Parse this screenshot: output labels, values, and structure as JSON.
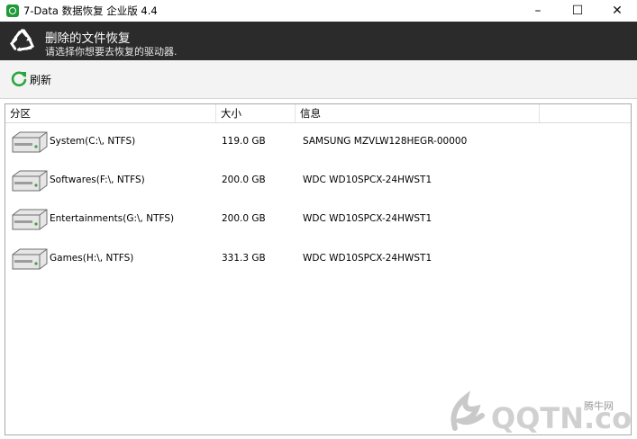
{
  "window": {
    "title": "7-Data 数据恢复 企业版 4.4",
    "buttons": [
      "–",
      "☐",
      "✕"
    ]
  },
  "banner": {
    "title": "删除的文件恢复",
    "subtitle": "请选择你想要去恢复的驱动器."
  },
  "toolbar": {
    "refresh_label": "刷新"
  },
  "table": {
    "columns": [
      "分区",
      "大小",
      "信息"
    ],
    "rows": [
      {
        "name": "System(C:\\, NTFS)",
        "size": "119.0 GB",
        "info": "SAMSUNG MZVLW128HEGR-00000"
      },
      {
        "name": "Softwares(F:\\, NTFS)",
        "size": "200.0 GB",
        "info": "WDC WD10SPCX-24HWST1"
      },
      {
        "name": "Entertainments(G:\\, NTFS)",
        "size": "200.0 GB",
        "info": "WDC WD10SPCX-24HWST1"
      },
      {
        "name": "Games(H:\\, NTFS)",
        "size": "331.3 GB",
        "info": "WDC WD10SPCX-24HWST1"
      }
    ]
  },
  "watermark": {
    "brand": "QQTN.com",
    "small": "腾牛网"
  },
  "colors": {
    "banner_bg": "#2b2b2b",
    "app_icon": "#1f9a3a",
    "refresh_icon": "#2aa63f"
  }
}
